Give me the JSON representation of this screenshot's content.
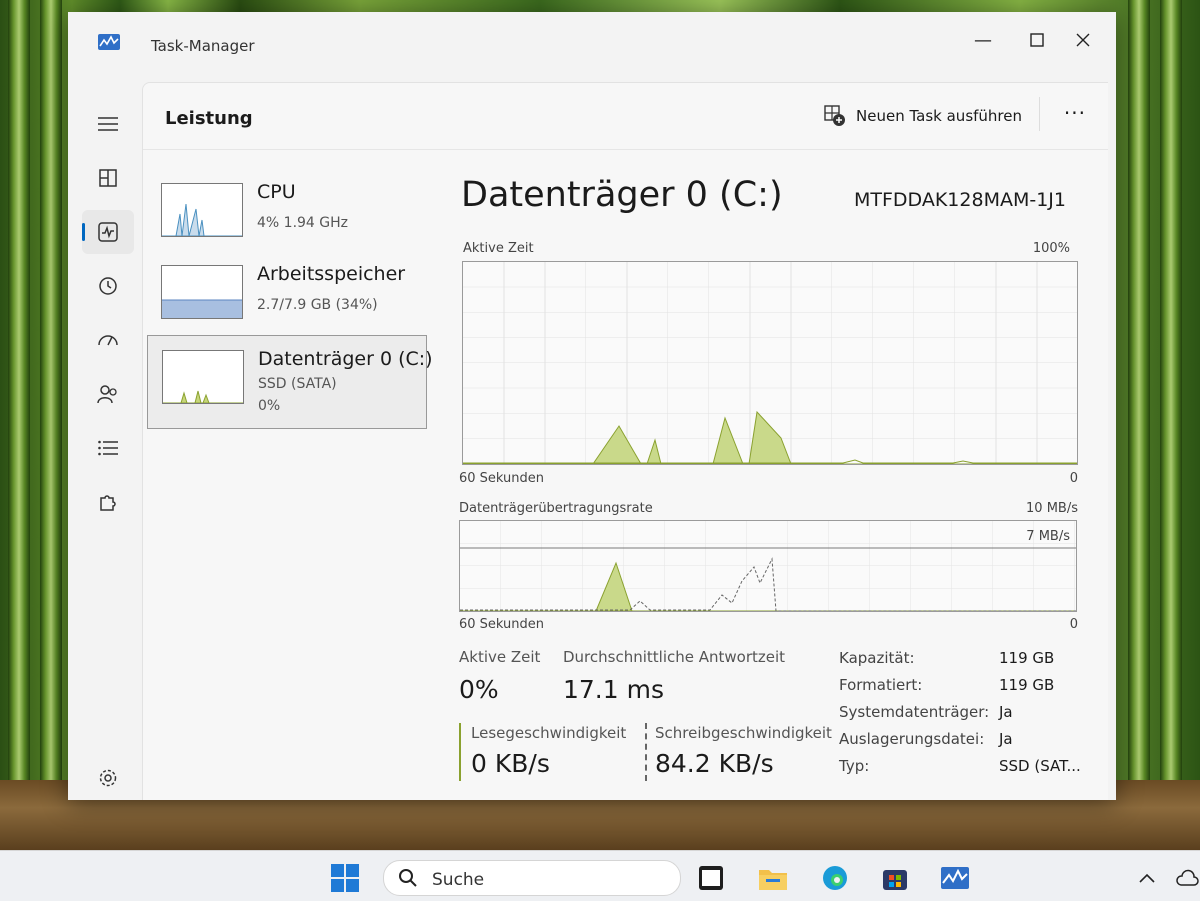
{
  "window": {
    "title": "Task-Manager"
  },
  "header": {
    "title": "Leistung",
    "run_task_label": "Neuen Task ausführen",
    "more_label": "···"
  },
  "resources": [
    {
      "name": "CPU",
      "sub1": "4%  1.94 GHz",
      "sub2": ""
    },
    {
      "name": "Arbeitsspeicher",
      "sub1": "2.7/7.9 GB (34%)",
      "sub2": ""
    },
    {
      "name": "Datenträger 0 (C:)",
      "sub1": "SSD (SATA)",
      "sub2": "0%"
    }
  ],
  "disk": {
    "title": "Datenträger 0 (C:)",
    "model": "MTFDDAK128MAM-1J1",
    "graph1": {
      "label": "Aktive Zeit",
      "max": "100%",
      "time": "60 Sekunden",
      "min": "0"
    },
    "graph2": {
      "label": "Datenträgerübertragungsrate",
      "max": "10 MB/s",
      "inner_max": "7 MB/s",
      "time": "60 Sekunden",
      "min": "0"
    },
    "stats": {
      "active_label": "Aktive Zeit",
      "active_value": "0%",
      "response_label": "Durchschnittliche Antwortzeit",
      "response_value": "17.1 ms",
      "read_label": "Lesegeschwindigkeit",
      "read_value": "0 KB/s",
      "write_label": "Schreibgeschwindigkeit",
      "write_value": "84.2 KB/s"
    },
    "properties": [
      {
        "key": "Kapazität:",
        "value": "119 GB"
      },
      {
        "key": "Formatiert:",
        "value": "119 GB"
      },
      {
        "key": "Systemdatenträger:",
        "value": "Ja"
      },
      {
        "key": "Auslagerungsdatei:",
        "value": "Ja"
      },
      {
        "key": "Typ:",
        "value": "SSD (SAT..."
      }
    ]
  },
  "taskbar": {
    "search_placeholder": "Suche"
  },
  "colors": {
    "accent": "#0067c0",
    "disk_graph": "#8aa12f",
    "cpu_graph": "#4a90c0",
    "memory_graph": "#9fb6d8"
  }
}
